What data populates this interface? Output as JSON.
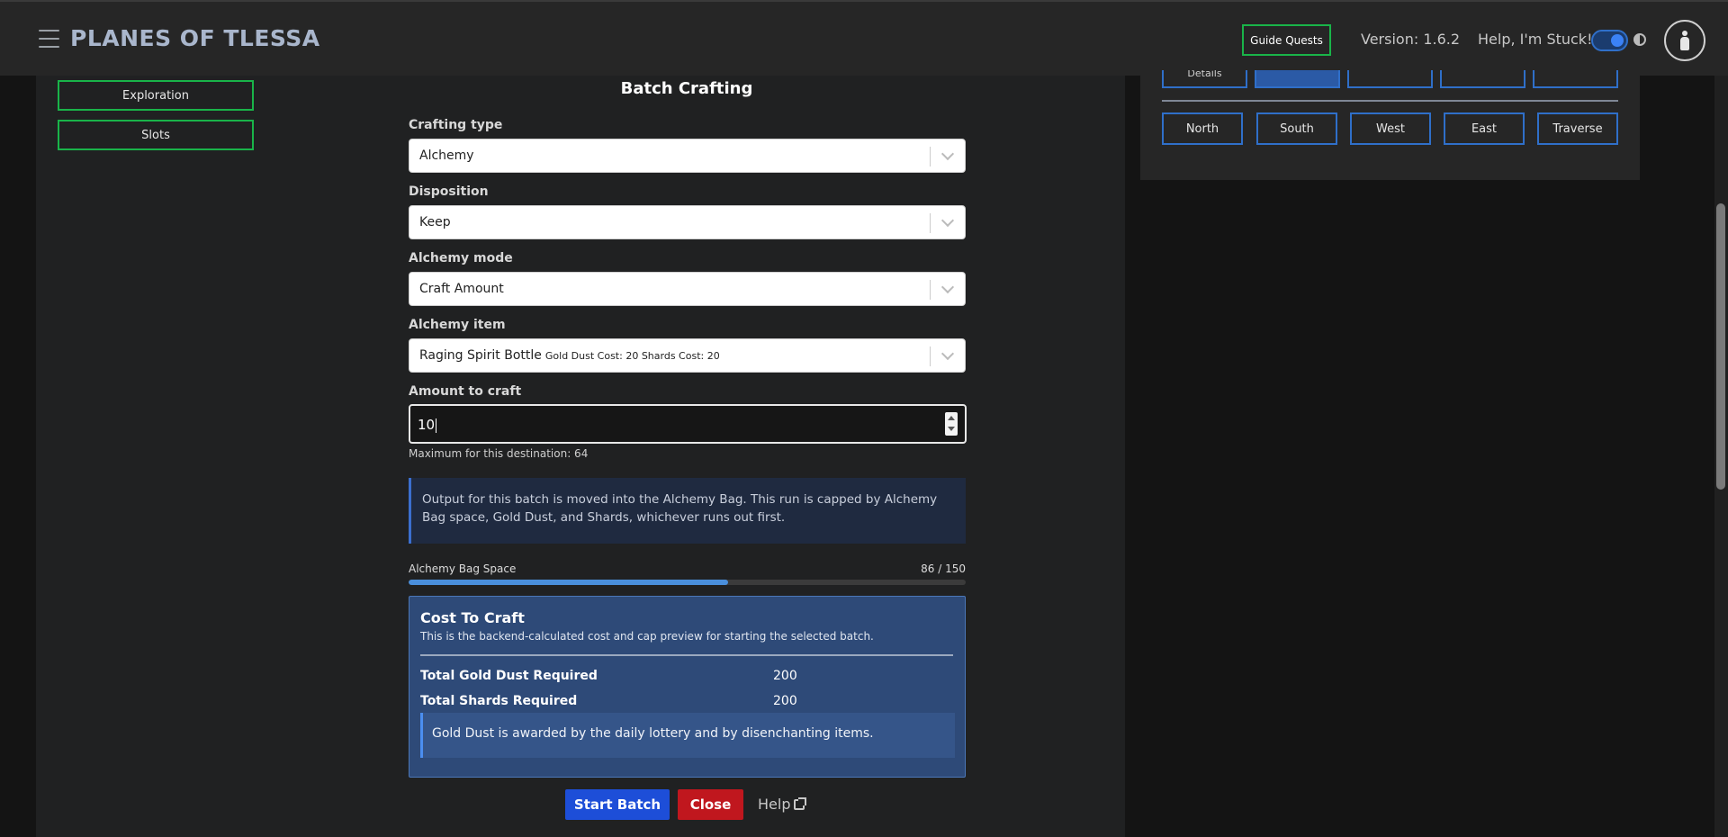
{
  "header": {
    "brand": "PLANES OF TLESSA",
    "guide_quests": "Guide Quests",
    "version": "Version: 1.6.2",
    "help_stuck": "Help, I'm Stuck!"
  },
  "sidebar": {
    "items": [
      {
        "label": "Exploration"
      },
      {
        "label": "Slots"
      }
    ]
  },
  "form": {
    "title": "Batch Crafting",
    "crafting_type": {
      "label": "Crafting type",
      "value": "Alchemy"
    },
    "disposition": {
      "label": "Disposition",
      "value": "Keep"
    },
    "alchemy_mode": {
      "label": "Alchemy mode",
      "value": "Craft Amount"
    },
    "alchemy_item": {
      "label": "Alchemy item",
      "value": "Raging Spirit Bottle",
      "cost_note": "Gold Dust Cost: 20 Shards Cost: 20"
    },
    "amount": {
      "label": "Amount to craft",
      "value": "10",
      "hint": "Maximum for this destination: 64"
    },
    "info": "Output for this batch is moved into the Alchemy Bag. This run is capped by Alchemy Bag space, Gold Dust, and Shards, whichever runs out first.",
    "bag": {
      "label": "Alchemy Bag Space",
      "count": "86 / 150",
      "fraction": 0.5733
    },
    "cost": {
      "title": "Cost To Craft",
      "subtitle": "This is the backend-calculated cost and cap preview for starting the selected batch.",
      "rows": [
        {
          "label": "Total Gold Dust Required",
          "value": "200"
        },
        {
          "label": "Total Shards Required",
          "value": "200"
        }
      ],
      "note": "Gold Dust is awarded by the daily lottery and by disenchanting items."
    },
    "actions": {
      "start": "Start Batch",
      "close": "Close",
      "help": "Help"
    }
  },
  "map": {
    "top_partial_label": "Details",
    "directions": [
      "North",
      "South",
      "West",
      "East",
      "Traverse"
    ]
  },
  "colors": {
    "accent_green": "#19b449",
    "accent_blue": "#2f6fc9",
    "start_button": "#1d4ed8",
    "close_button": "#c0171e",
    "cost_panel": "#2e4a78"
  }
}
